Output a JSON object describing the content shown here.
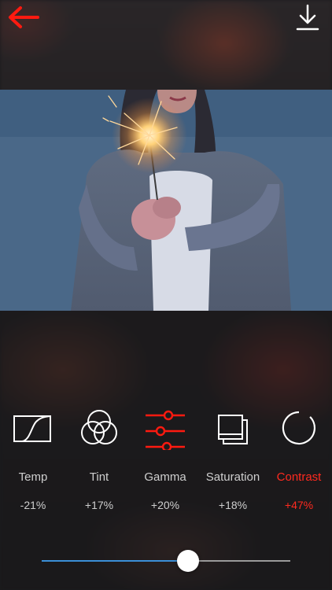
{
  "header": {
    "back_icon": "arrow-left-icon",
    "download_icon": "download-icon",
    "accent": "#ff1a10"
  },
  "photo": {
    "subject_icon": "photo-image"
  },
  "tools": [
    {
      "label": "Temp",
      "value": "-21%",
      "icon": "curve-square-icon"
    },
    {
      "label": "Tint",
      "value": "+17%",
      "icon": "three-circles-icon"
    },
    {
      "label": "Gamma",
      "value": "+20%",
      "icon": "sliders-icon"
    },
    {
      "label": "Saturation",
      "value": "+18%",
      "icon": "stacked-squares-icon"
    },
    {
      "label": "Contrast",
      "value": "+47%",
      "icon": "open-circle-icon"
    }
  ],
  "active_tool": "Contrast",
  "slider": {
    "level_percent": 59,
    "track_fill_color": "#3b8fd8"
  }
}
